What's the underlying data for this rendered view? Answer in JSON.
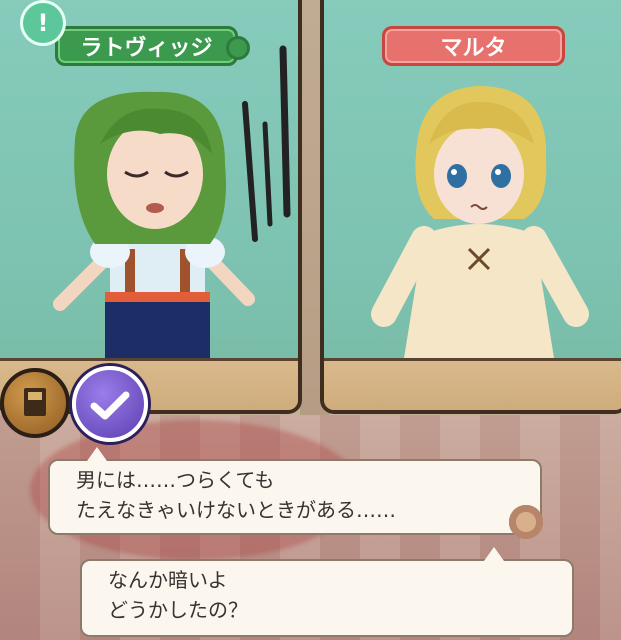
{
  "characters": {
    "left": {
      "name": "ラトヴィッジ",
      "plate_color": "#3c9a4f"
    },
    "right": {
      "name": "マルタ",
      "plate_color": "#e7716c"
    }
  },
  "alert": {
    "symbol": "!"
  },
  "dialogue": {
    "speaker_line_1": "男には……つらくても",
    "speaker_line_2": "たえなきゃいけないときがある……",
    "reply_line_1": "なんか暗いよ",
    "reply_line_2": "どうかしたの？"
  },
  "colors": {
    "panel_bg": "#7fc4b4",
    "frame": "#3f2e20",
    "bubble_bg": "#fbf7ef"
  },
  "icons": {
    "alert": "exclamation-icon",
    "left_button": "book-icon",
    "right_button": "check-icon",
    "replay": "replay-icon"
  }
}
